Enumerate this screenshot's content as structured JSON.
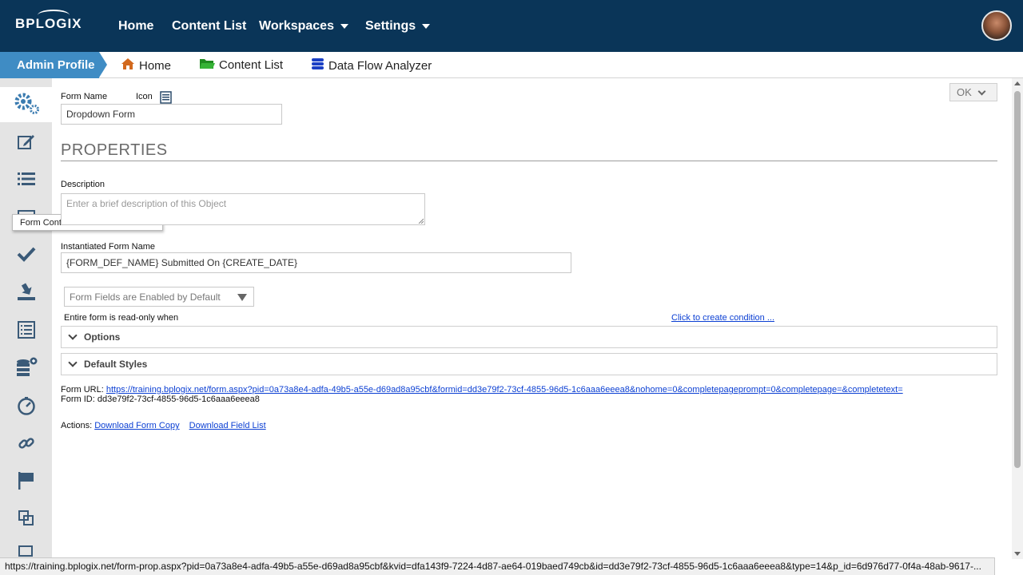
{
  "nav": {
    "logo": "BPLOGIX",
    "items": [
      {
        "label": "Home"
      },
      {
        "label": "Content List"
      },
      {
        "label": "Workspaces"
      },
      {
        "label": "Settings"
      }
    ]
  },
  "subbar": {
    "crumb": "Admin Profile",
    "items": [
      {
        "label": "Home",
        "icon": "home-icon"
      },
      {
        "label": "Content List",
        "icon": "folder-icon"
      },
      {
        "label": "Data Flow Analyzer",
        "icon": "database-icon"
      }
    ]
  },
  "sidebar": {
    "tooltip": "Form Controls",
    "icons": [
      "gears-icon",
      "edit-icon",
      "list-icon",
      "form-controls-icon",
      "check-icon",
      "download-icon",
      "document-list-icon",
      "database-add-icon",
      "dashboard-icon",
      "link-icon",
      "flag-icon",
      "copy-icon",
      "more-icon"
    ]
  },
  "form": {
    "name_label": "Form Name",
    "icon_label": "Icon",
    "name_value": "Dropdown Form",
    "ok_label": "OK",
    "properties_heading": "PROPERTIES",
    "description_label": "Description",
    "description_placeholder": "Enter a brief description of this Object",
    "instantiated_label": "Instantiated Form Name",
    "instantiated_value": "{FORM_DEF_NAME} Submitted On {CREATE_DATE}",
    "fields_select_value": "Form Fields are Enabled by Default",
    "readonly_label": "Entire form is read-only when",
    "condition_link": "Click to create condition ...",
    "options_panel": "Options",
    "default_styles_panel": "Default Styles",
    "url_label": "Form URL:",
    "url_value": "https://training.bplogix.net/form.aspx?pid=0a73a8e4-adfa-49b5-a55e-d69ad8a95cbf&formid=dd3e79f2-73cf-4855-96d5-1c6aaa6eeea8&nohome=0&completepageprompt=0&completepage=&completetext=",
    "id_label": "Form ID:",
    "id_value": "dd3e79f2-73cf-4855-96d5-1c6aaa6eeea8",
    "actions_label": "Actions:",
    "action_download_copy": "Download Form Copy",
    "action_download_fields": "Download Field List"
  },
  "status": {
    "url": "https://training.bplogix.net/form-prop.aspx?pid=0a73a8e4-adfa-49b5-a55e-d69ad8a95cbf&kvid=dfa143f9-7224-4d87-ae64-019baed749cb&id=dd3e79f2-73cf-4855-96d5-1c6aaa6eeea8&type=14&p_id=6d976d77-0f4a-48ab-9617-..."
  },
  "colors": {
    "nav_bg": "#0a3558",
    "crumb_bg": "#3f8cc4",
    "link": "#0b3fd3",
    "sidebar_bg": "#e4e4e4"
  }
}
